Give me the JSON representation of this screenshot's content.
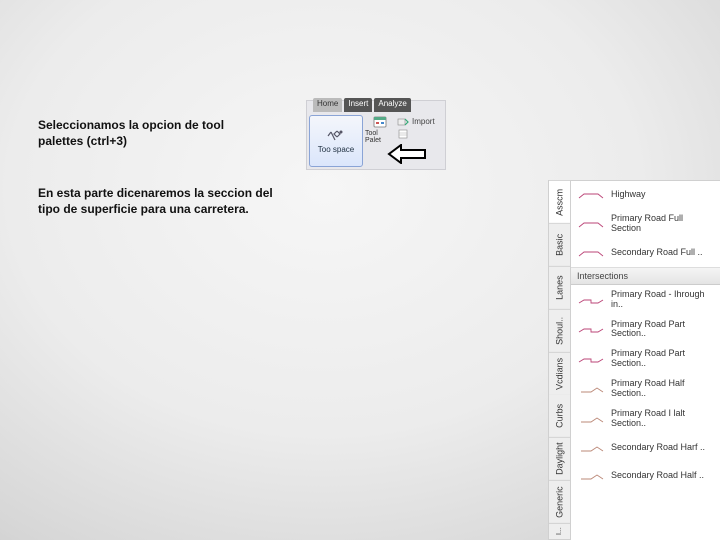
{
  "text": {
    "p1": "Seleccionamos la opcion de tool palettes (ctrl+3)",
    "p2": "En esta parte dicenaremos la seccion del tipo de superficie para una carretera."
  },
  "ribbon": {
    "tabs": {
      "a": "Home",
      "b": "Insert",
      "c": "Analyze"
    },
    "toolspace": "Too space",
    "toolpal": "Tool Palet",
    "import": "Import"
  },
  "palette": {
    "tabs": {
      "asscm": "Asscm",
      "basic": "Basic",
      "lanes": "Lanes",
      "shoul": "Shoul..",
      "medians": "Vcdians",
      "curbs": "Curbs",
      "daylight": "Daylight",
      "generic": "Generic",
      "tiny": "I..."
    },
    "groups": {
      "g1": "",
      "g2": "Intersections"
    },
    "items": {
      "i0": "Highway",
      "i1": "Primary Road Full Section",
      "i2": "Secondary Road Full ..",
      "i3": "Primary Road - Ihrough in..",
      "i4": "Primary Road Part Section..",
      "i5": "Primary Road Part Section..",
      "i6": "Primary Road Half Section..",
      "i7": "Primary Road I lalt Section..",
      "i8": "Secondary Road Harf ..",
      "i9": "Secondary Road Half .."
    }
  }
}
